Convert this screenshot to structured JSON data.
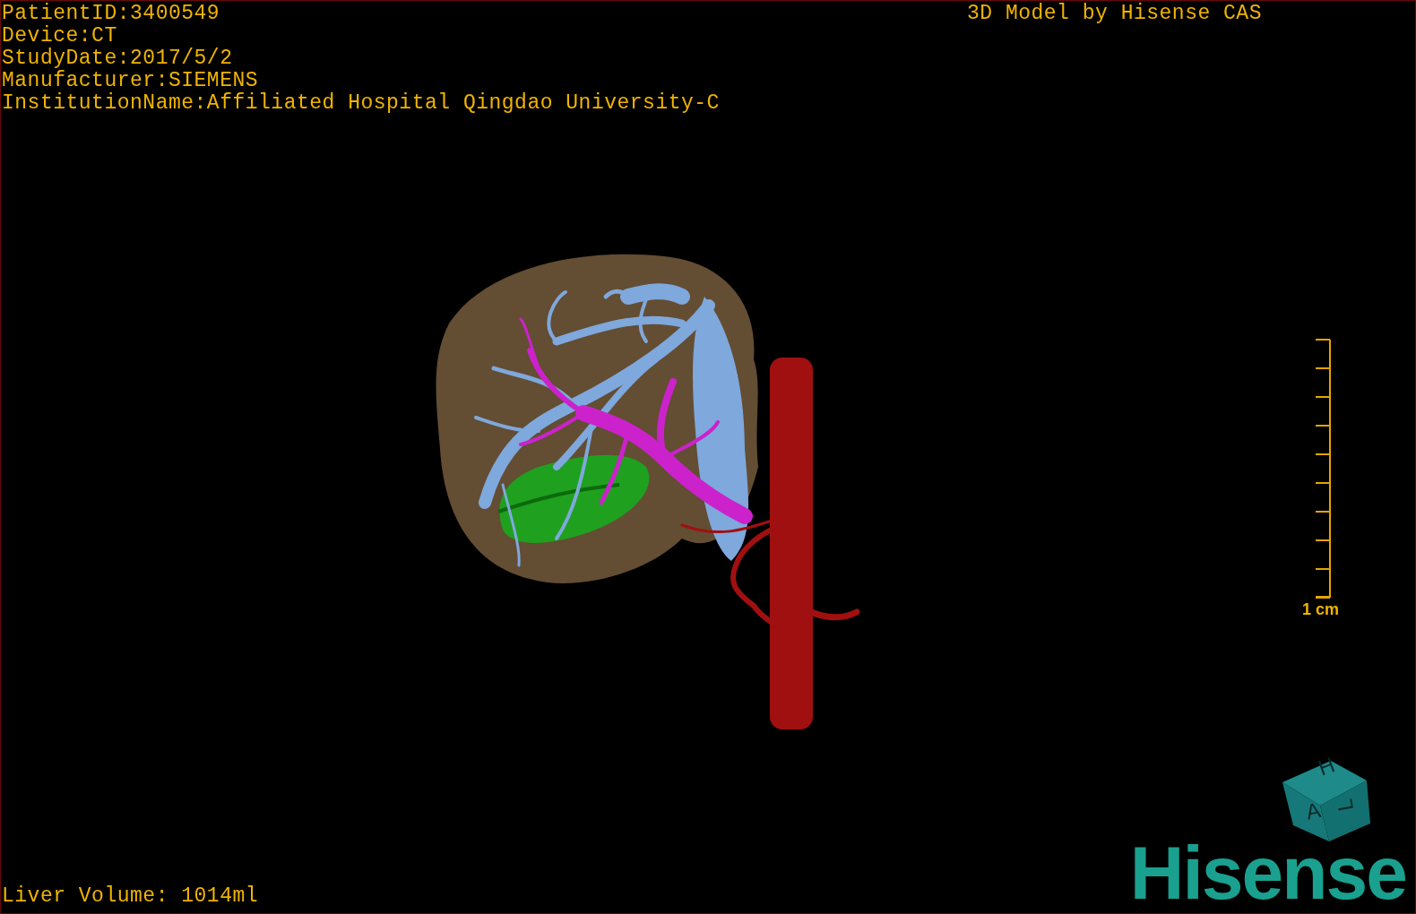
{
  "patient_info": [
    "PatientID:3400549",
    "Device:CT",
    "StudyDate:2017/5/2",
    "Manufacturer:SIEMENS",
    "InstitutionName:Affiliated Hospital Qingdao University-C"
  ],
  "title": "3D Model by Hisense CAS",
  "scale_bar": {
    "label": "1 cm"
  },
  "orientation_cube": {
    "faces": [
      {
        "kind": "top",
        "label": "H"
      },
      {
        "kind": "front",
        "label": "A"
      },
      {
        "kind": "side",
        "label": "L"
      }
    ]
  },
  "liver_volume": "Liver Volume: 1014ml",
  "logo": "Hisense"
}
